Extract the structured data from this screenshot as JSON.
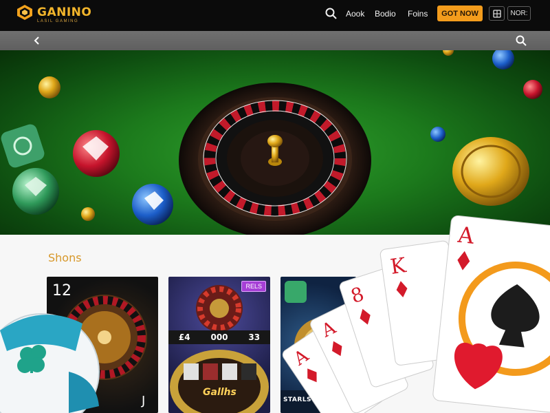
{
  "header": {
    "logo_text": "GANINO",
    "logo_subtext": "LASIL GAMING",
    "nav": [
      "Aook",
      "Bodio",
      "Foins"
    ],
    "cta_label": "GOT NOW",
    "icon_box_label": "",
    "lang_label": "NOR:"
  },
  "subbar": {},
  "section": {
    "title": "Shons"
  },
  "tiles": [
    {
      "top_label": "12",
      "corner_label": "J"
    },
    {
      "badge": "RELS",
      "bar": [
        "£4",
        "000",
        "33"
      ],
      "brand": "Gallhs"
    },
    {
      "title": "STARLSTIANNA"
    }
  ],
  "colors": {
    "accent": "#f39c1c",
    "logo": "#f2b52b",
    "section_title": "#d7982a",
    "hero_green": "#1c7a1c"
  },
  "icons": [
    "logo-mark-icon",
    "search-icon",
    "back-chevron-icon",
    "subbar-search-icon",
    "window-icon"
  ]
}
